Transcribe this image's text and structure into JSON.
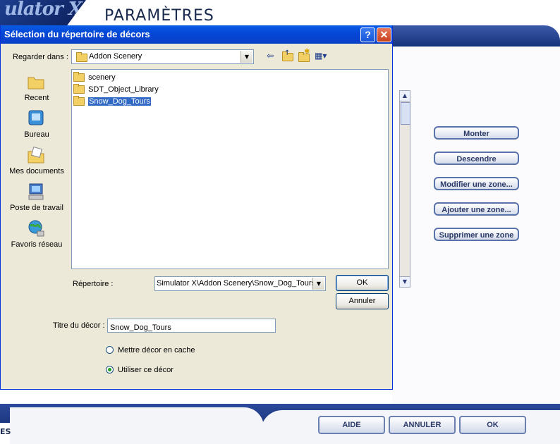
{
  "background": {
    "logo_text": "ulator X",
    "page_title": "PARAMÈTRES",
    "side_buttons": [
      "Monter",
      "Descendre",
      "Modifier une zone...",
      "Ajouter une zone...",
      "Supprimer une zone"
    ],
    "left_edge_text": "ES",
    "bottom_buttons": {
      "help": "AIDE",
      "cancel": "ANNULER",
      "ok": "OK"
    }
  },
  "dialog": {
    "title": "Sélection du répertoire de décors",
    "help_glyph": "?",
    "close_glyph": "✕",
    "look_in_label": "Regarder dans :",
    "look_in_value": "Addon Scenery",
    "places": [
      {
        "label": "Recent",
        "icon": "recent-folder-icon"
      },
      {
        "label": "Bureau",
        "icon": "desktop-icon"
      },
      {
        "label": "Mes documents",
        "icon": "my-documents-icon"
      },
      {
        "label": "Poste de travail",
        "icon": "my-computer-icon"
      },
      {
        "label": "Favoris réseau",
        "icon": "network-places-icon"
      }
    ],
    "files": [
      "scenery",
      "SDT_Object_Library",
      "Snow_Dog_Tours"
    ],
    "selected_file": "Snow_Dog_Tours",
    "directory_label": "Répertoire :",
    "directory_value": "Simulator X\\Addon Scenery\\Snow_Dog_Tours",
    "ok_label": "OK",
    "cancel_label": "Annuler",
    "scenery_title_label": "Titre du décor :",
    "scenery_title_value": "Snow_Dog_Tours",
    "radio_cache_label": "Mettre décor en cache",
    "radio_use_label": "Utiliser ce décor",
    "radio_selected": "use"
  },
  "colors": {
    "title_bar": "#0a5ce6",
    "selection": "#316ac5",
    "dialog_bg": "#ece9d8",
    "fsx_blue": "#15307a"
  }
}
